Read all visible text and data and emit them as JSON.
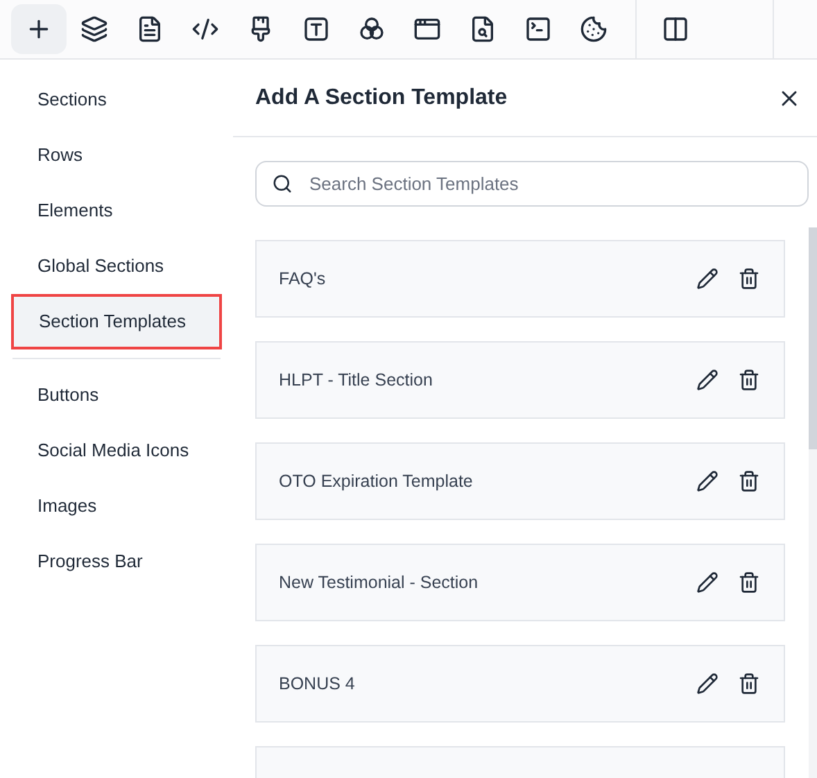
{
  "toolbar": {
    "tools": [
      {
        "kind": "plus",
        "selected": true
      },
      {
        "kind": "layers",
        "selected": false
      },
      {
        "kind": "page",
        "selected": false
      },
      {
        "kind": "code",
        "selected": false
      },
      {
        "kind": "brush",
        "selected": false
      },
      {
        "kind": "text",
        "selected": false
      },
      {
        "kind": "circles",
        "selected": false
      },
      {
        "kind": "window",
        "selected": false
      },
      {
        "kind": "search-page",
        "selected": false
      },
      {
        "kind": "terminal",
        "selected": false
      },
      {
        "kind": "cookie",
        "selected": false
      }
    ],
    "extra_tools": [
      {
        "kind": "columns",
        "selected": false
      }
    ]
  },
  "sidebar": {
    "groups": [
      [
        {
          "label": "Sections",
          "selected": false
        },
        {
          "label": "Rows",
          "selected": false
        },
        {
          "label": "Elements",
          "selected": false
        },
        {
          "label": "Global Sections",
          "selected": false
        },
        {
          "label": "Section Templates",
          "selected": true
        }
      ],
      [
        {
          "label": "Buttons",
          "selected": false
        },
        {
          "label": "Social Media Icons",
          "selected": false
        },
        {
          "label": "Images",
          "selected": false
        },
        {
          "label": "Progress Bar",
          "selected": false
        }
      ]
    ]
  },
  "panel": {
    "title": "Add A Section Template",
    "search": {
      "placeholder": "Search Section Templates"
    },
    "templates": [
      {
        "name": "FAQ's"
      },
      {
        "name": "HLPT - Title Section"
      },
      {
        "name": "OTO Expiration Template"
      },
      {
        "name": "New Testimonial - Section"
      },
      {
        "name": "BONUS 4"
      }
    ]
  }
}
